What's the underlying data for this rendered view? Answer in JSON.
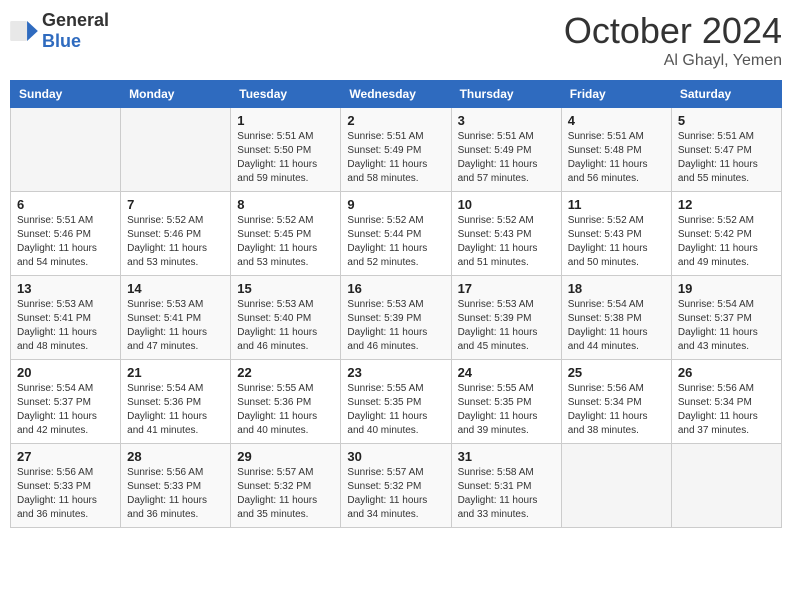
{
  "header": {
    "logo_general": "General",
    "logo_blue": "Blue",
    "month_title": "October 2024",
    "location": "Al Ghayl, Yemen"
  },
  "days_of_week": [
    "Sunday",
    "Monday",
    "Tuesday",
    "Wednesday",
    "Thursday",
    "Friday",
    "Saturday"
  ],
  "weeks": [
    [
      {
        "day": "",
        "sunrise": "",
        "sunset": "",
        "daylight": ""
      },
      {
        "day": "",
        "sunrise": "",
        "sunset": "",
        "daylight": ""
      },
      {
        "day": "1",
        "sunrise": "Sunrise: 5:51 AM",
        "sunset": "Sunset: 5:50 PM",
        "daylight": "Daylight: 11 hours and 59 minutes."
      },
      {
        "day": "2",
        "sunrise": "Sunrise: 5:51 AM",
        "sunset": "Sunset: 5:49 PM",
        "daylight": "Daylight: 11 hours and 58 minutes."
      },
      {
        "day": "3",
        "sunrise": "Sunrise: 5:51 AM",
        "sunset": "Sunset: 5:49 PM",
        "daylight": "Daylight: 11 hours and 57 minutes."
      },
      {
        "day": "4",
        "sunrise": "Sunrise: 5:51 AM",
        "sunset": "Sunset: 5:48 PM",
        "daylight": "Daylight: 11 hours and 56 minutes."
      },
      {
        "day": "5",
        "sunrise": "Sunrise: 5:51 AM",
        "sunset": "Sunset: 5:47 PM",
        "daylight": "Daylight: 11 hours and 55 minutes."
      }
    ],
    [
      {
        "day": "6",
        "sunrise": "Sunrise: 5:51 AM",
        "sunset": "Sunset: 5:46 PM",
        "daylight": "Daylight: 11 hours and 54 minutes."
      },
      {
        "day": "7",
        "sunrise": "Sunrise: 5:52 AM",
        "sunset": "Sunset: 5:46 PM",
        "daylight": "Daylight: 11 hours and 53 minutes."
      },
      {
        "day": "8",
        "sunrise": "Sunrise: 5:52 AM",
        "sunset": "Sunset: 5:45 PM",
        "daylight": "Daylight: 11 hours and 53 minutes."
      },
      {
        "day": "9",
        "sunrise": "Sunrise: 5:52 AM",
        "sunset": "Sunset: 5:44 PM",
        "daylight": "Daylight: 11 hours and 52 minutes."
      },
      {
        "day": "10",
        "sunrise": "Sunrise: 5:52 AM",
        "sunset": "Sunset: 5:43 PM",
        "daylight": "Daylight: 11 hours and 51 minutes."
      },
      {
        "day": "11",
        "sunrise": "Sunrise: 5:52 AM",
        "sunset": "Sunset: 5:43 PM",
        "daylight": "Daylight: 11 hours and 50 minutes."
      },
      {
        "day": "12",
        "sunrise": "Sunrise: 5:52 AM",
        "sunset": "Sunset: 5:42 PM",
        "daylight": "Daylight: 11 hours and 49 minutes."
      }
    ],
    [
      {
        "day": "13",
        "sunrise": "Sunrise: 5:53 AM",
        "sunset": "Sunset: 5:41 PM",
        "daylight": "Daylight: 11 hours and 48 minutes."
      },
      {
        "day": "14",
        "sunrise": "Sunrise: 5:53 AM",
        "sunset": "Sunset: 5:41 PM",
        "daylight": "Daylight: 11 hours and 47 minutes."
      },
      {
        "day": "15",
        "sunrise": "Sunrise: 5:53 AM",
        "sunset": "Sunset: 5:40 PM",
        "daylight": "Daylight: 11 hours and 46 minutes."
      },
      {
        "day": "16",
        "sunrise": "Sunrise: 5:53 AM",
        "sunset": "Sunset: 5:39 PM",
        "daylight": "Daylight: 11 hours and 46 minutes."
      },
      {
        "day": "17",
        "sunrise": "Sunrise: 5:53 AM",
        "sunset": "Sunset: 5:39 PM",
        "daylight": "Daylight: 11 hours and 45 minutes."
      },
      {
        "day": "18",
        "sunrise": "Sunrise: 5:54 AM",
        "sunset": "Sunset: 5:38 PM",
        "daylight": "Daylight: 11 hours and 44 minutes."
      },
      {
        "day": "19",
        "sunrise": "Sunrise: 5:54 AM",
        "sunset": "Sunset: 5:37 PM",
        "daylight": "Daylight: 11 hours and 43 minutes."
      }
    ],
    [
      {
        "day": "20",
        "sunrise": "Sunrise: 5:54 AM",
        "sunset": "Sunset: 5:37 PM",
        "daylight": "Daylight: 11 hours and 42 minutes."
      },
      {
        "day": "21",
        "sunrise": "Sunrise: 5:54 AM",
        "sunset": "Sunset: 5:36 PM",
        "daylight": "Daylight: 11 hours and 41 minutes."
      },
      {
        "day": "22",
        "sunrise": "Sunrise: 5:55 AM",
        "sunset": "Sunset: 5:36 PM",
        "daylight": "Daylight: 11 hours and 40 minutes."
      },
      {
        "day": "23",
        "sunrise": "Sunrise: 5:55 AM",
        "sunset": "Sunset: 5:35 PM",
        "daylight": "Daylight: 11 hours and 40 minutes."
      },
      {
        "day": "24",
        "sunrise": "Sunrise: 5:55 AM",
        "sunset": "Sunset: 5:35 PM",
        "daylight": "Daylight: 11 hours and 39 minutes."
      },
      {
        "day": "25",
        "sunrise": "Sunrise: 5:56 AM",
        "sunset": "Sunset: 5:34 PM",
        "daylight": "Daylight: 11 hours and 38 minutes."
      },
      {
        "day": "26",
        "sunrise": "Sunrise: 5:56 AM",
        "sunset": "Sunset: 5:34 PM",
        "daylight": "Daylight: 11 hours and 37 minutes."
      }
    ],
    [
      {
        "day": "27",
        "sunrise": "Sunrise: 5:56 AM",
        "sunset": "Sunset: 5:33 PM",
        "daylight": "Daylight: 11 hours and 36 minutes."
      },
      {
        "day": "28",
        "sunrise": "Sunrise: 5:56 AM",
        "sunset": "Sunset: 5:33 PM",
        "daylight": "Daylight: 11 hours and 36 minutes."
      },
      {
        "day": "29",
        "sunrise": "Sunrise: 5:57 AM",
        "sunset": "Sunset: 5:32 PM",
        "daylight": "Daylight: 11 hours and 35 minutes."
      },
      {
        "day": "30",
        "sunrise": "Sunrise: 5:57 AM",
        "sunset": "Sunset: 5:32 PM",
        "daylight": "Daylight: 11 hours and 34 minutes."
      },
      {
        "day": "31",
        "sunrise": "Sunrise: 5:58 AM",
        "sunset": "Sunset: 5:31 PM",
        "daylight": "Daylight: 11 hours and 33 minutes."
      },
      {
        "day": "",
        "sunrise": "",
        "sunset": "",
        "daylight": ""
      },
      {
        "day": "",
        "sunrise": "",
        "sunset": "",
        "daylight": ""
      }
    ]
  ]
}
